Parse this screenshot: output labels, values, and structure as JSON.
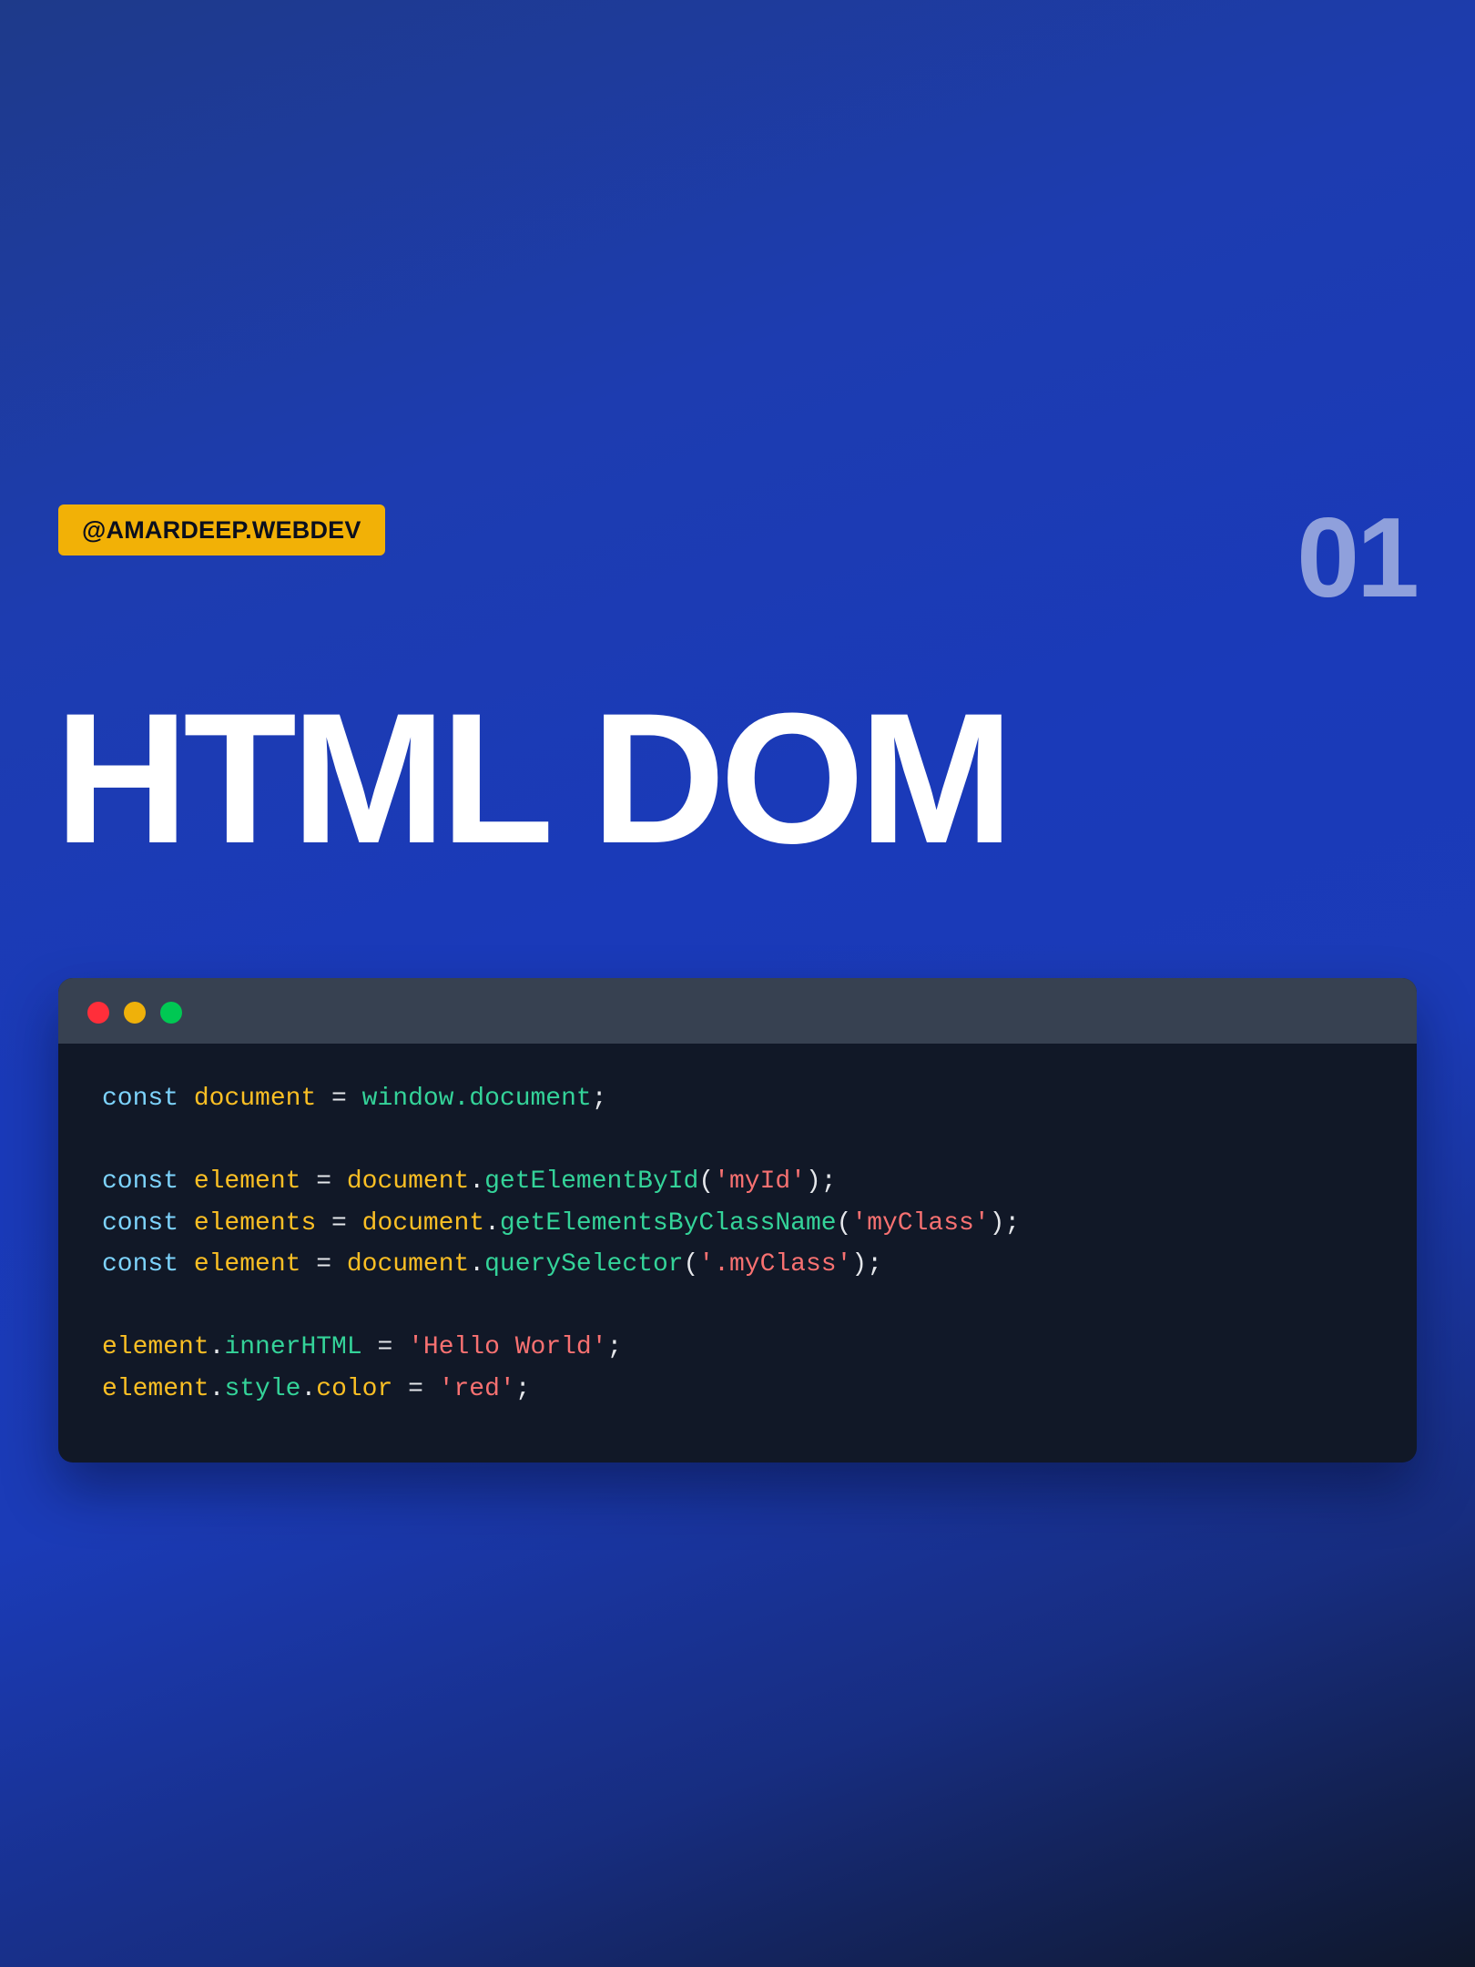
{
  "badge": {
    "label": "@AMARDEEP.WEBDEV"
  },
  "page_number": "01",
  "title": "HTML DOM",
  "window_controls": {
    "close_color": "#ff2e3a",
    "minimize_color": "#efb10a",
    "maximize_color": "#00c853"
  },
  "code": {
    "lines": [
      [
        {
          "t": "kw",
          "v": "const"
        },
        {
          "t": "pn",
          "v": " "
        },
        {
          "t": "var",
          "v": "document"
        },
        {
          "t": "pn",
          "v": " = "
        },
        {
          "t": "fn",
          "v": "window.document"
        },
        {
          "t": "pn",
          "v": ";"
        }
      ],
      [],
      [
        {
          "t": "kw",
          "v": "const"
        },
        {
          "t": "pn",
          "v": " "
        },
        {
          "t": "var",
          "v": "element"
        },
        {
          "t": "pn",
          "v": " = "
        },
        {
          "t": "var",
          "v": "document"
        },
        {
          "t": "pn",
          "v": "."
        },
        {
          "t": "fn",
          "v": "getElementById"
        },
        {
          "t": "pn",
          "v": "("
        },
        {
          "t": "str",
          "v": "'myId'"
        },
        {
          "t": "pn",
          "v": ");"
        }
      ],
      [
        {
          "t": "kw",
          "v": "const"
        },
        {
          "t": "pn",
          "v": " "
        },
        {
          "t": "var",
          "v": "elements"
        },
        {
          "t": "pn",
          "v": " = "
        },
        {
          "t": "var",
          "v": "document"
        },
        {
          "t": "pn",
          "v": "."
        },
        {
          "t": "fn",
          "v": "getElementsByClassName"
        },
        {
          "t": "pn",
          "v": "("
        },
        {
          "t": "str",
          "v": "'myClass'"
        },
        {
          "t": "pn",
          "v": ");"
        }
      ],
      [
        {
          "t": "kw",
          "v": "const"
        },
        {
          "t": "pn",
          "v": " "
        },
        {
          "t": "var",
          "v": "element"
        },
        {
          "t": "pn",
          "v": " = "
        },
        {
          "t": "var",
          "v": "document"
        },
        {
          "t": "pn",
          "v": "."
        },
        {
          "t": "fn",
          "v": "querySelector"
        },
        {
          "t": "pn",
          "v": "("
        },
        {
          "t": "str",
          "v": "'.myClass'"
        },
        {
          "t": "pn",
          "v": ");"
        }
      ],
      [],
      [
        {
          "t": "var",
          "v": "element"
        },
        {
          "t": "pn",
          "v": "."
        },
        {
          "t": "fn",
          "v": "innerHTML"
        },
        {
          "t": "pn",
          "v": " = "
        },
        {
          "t": "str",
          "v": "'Hello World'"
        },
        {
          "t": "pn",
          "v": ";"
        }
      ],
      [
        {
          "t": "var",
          "v": "element"
        },
        {
          "t": "pn",
          "v": "."
        },
        {
          "t": "fn",
          "v": "style"
        },
        {
          "t": "pn",
          "v": "."
        },
        {
          "t": "var",
          "v": "color"
        },
        {
          "t": "pn",
          "v": " = "
        },
        {
          "t": "str",
          "v": "'red'"
        },
        {
          "t": "pn",
          "v": ";"
        }
      ]
    ]
  }
}
